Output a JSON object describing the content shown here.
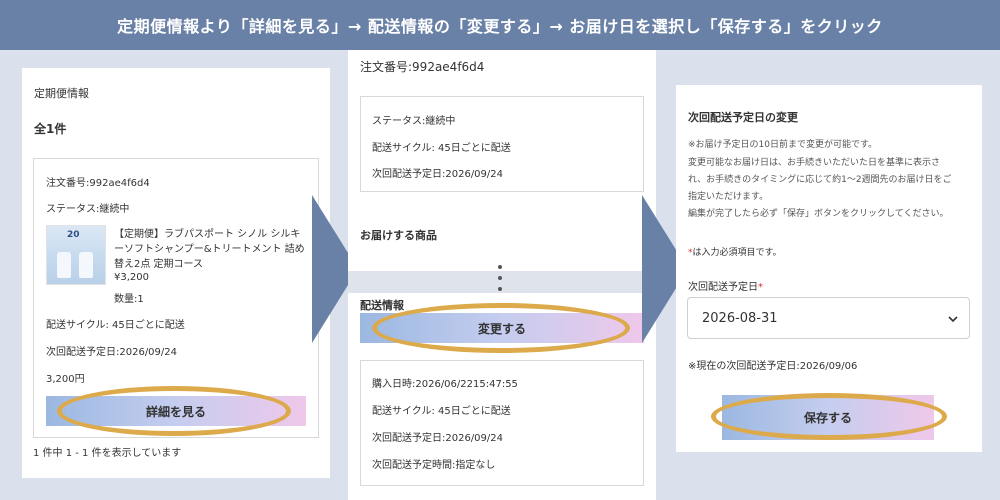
{
  "banner": {
    "instruction": "定期便情報より「詳細を見る」→ 配送情報の「変更する」→ お届け日を選択し「保存する」をクリック"
  },
  "left": {
    "heading": "定期便情報",
    "count": "全1件",
    "order_no": "注文番号:992ae4f6d4",
    "status": "ステータス:継続中",
    "product_line1": "【定期便】ラブパスポート シノル シルキ",
    "product_line2": "ーソフトシャンプー&トリートメント 詰め",
    "product_line3": "替え2点 定期コース",
    "price": "¥3,200",
    "qty": "数量:1",
    "cycle": "配送サイクル: 45日ごとに配送",
    "next_date": "次回配送予定日:2026/09/24",
    "total": "3,200円",
    "detail_button": "詳細を見る",
    "pager": "1 件中 1 - 1 件を表示しています",
    "thumb_badge": "20"
  },
  "middle": {
    "order_no": "注文番号:992ae4f6d4",
    "status": "ステータス:継続中",
    "cycle": "配送サイクル: 45日ごとに配送",
    "next_date": "次回配送予定日:2026/09/24",
    "items_heading": "お届けする商品",
    "shipping_heading": "配送情報",
    "change_button": "変更する",
    "purchase_date": "購入日時:2026/06/2215:47:55",
    "cycle2": "配送サイクル: 45日ごとに配送",
    "next_date2": "次回配送予定日:2026/09/24",
    "time": "次回配送予定時間:指定なし"
  },
  "right": {
    "heading": "次回配送予定日の変更",
    "note1": "※お届け予定日の10日前まで変更が可能です。",
    "note2": "変更可能なお届け日は、お手続きいただいた日を基準に表示さ",
    "note3": "れ、お手続きのタイミングに応じて約1～2週間先のお届け日をご",
    "note4": "指定いただけます。",
    "note5": "編集が完了したら必ず「保存」ボタンをクリックしてください。",
    "required_mark": "*",
    "required_note": "は入力必須項目です。",
    "field_label": "次回配送予定日",
    "field_required": "*",
    "select_value": "2026-08-31",
    "current_date": "※現在の次回配送予定日:2026/09/06",
    "save_button": "保存する"
  },
  "colors": {
    "banner_bg": "#6980a7",
    "page_bg": "#dbe1ec",
    "highlight_ring": "#dcaa4b",
    "arrow": "#6980a7",
    "required": "#d33333"
  },
  "icons": {
    "select_arrow": "chevron-down-icon",
    "more": "vertical-dots-icon",
    "flow_arrow": "right-arrow-icon"
  }
}
